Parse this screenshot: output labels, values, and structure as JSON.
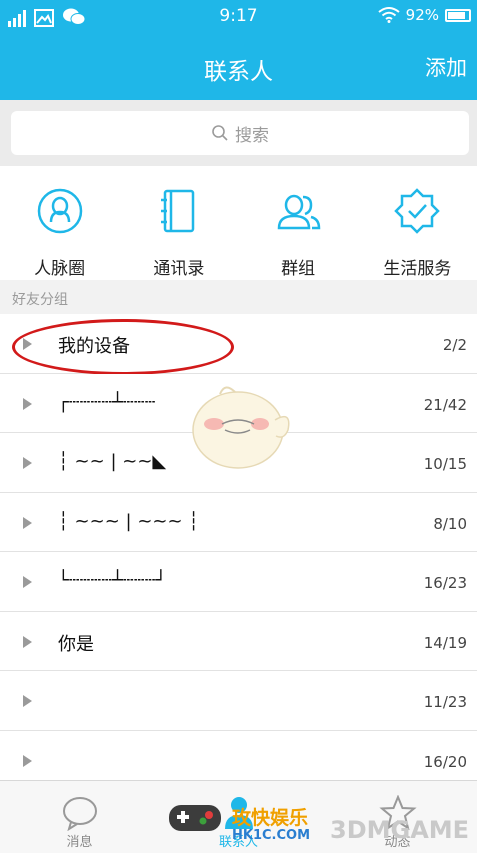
{
  "status_bar": {
    "time": "9:17",
    "battery": "92%"
  },
  "header": {
    "title": "联系人",
    "add_label": "添加"
  },
  "search": {
    "placeholder": "搜索"
  },
  "features": [
    {
      "label": "人脉圈",
      "icon": "contacts-circle-icon"
    },
    {
      "label": "通讯录",
      "icon": "address-book-icon"
    },
    {
      "label": "群组",
      "icon": "group-icon"
    },
    {
      "label": "生活服务",
      "icon": "life-service-icon"
    }
  ],
  "section_header": "好友分组",
  "groups": [
    {
      "name": "我的设备",
      "count": "2/2"
    },
    {
      "name": "┌┄┄┄┄┴┄┄┄",
      "count": "21/42"
    },
    {
      "name": "┆ ~~ | ~~◣",
      "count": "10/15"
    },
    {
      "name": "┆ ~~~ | ~~~ ┆",
      "count": "8/10"
    },
    {
      "name": "└┄┄┄┄┴┄┄┄┘",
      "count": "16/23"
    },
    {
      "name": "你是",
      "count": "14/19"
    },
    {
      "name": "",
      "count": "11/23"
    },
    {
      "name": "",
      "count": "16/20"
    }
  ],
  "bottom_nav": [
    {
      "label": "消息",
      "icon": "message-icon"
    },
    {
      "label": "联系人",
      "icon": "contacts-icon"
    },
    {
      "label": "动态",
      "icon": "star-icon"
    }
  ],
  "watermarks": {
    "line1": "玫快娱乐",
    "line2": "HK1C.COM",
    "line3": "3DMGAME"
  },
  "colors": {
    "accent": "#1fb7e8",
    "highlight": "#d21a1a"
  }
}
